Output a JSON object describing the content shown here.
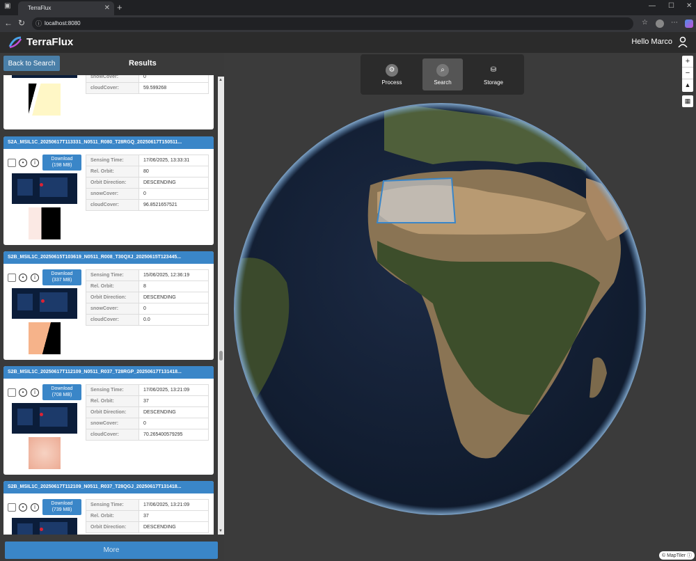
{
  "browser": {
    "tab_title": "TerraFlux",
    "url": "localhost:8080"
  },
  "app": {
    "name": "TerraFlux",
    "greeting": "Hello Marco"
  },
  "panel": {
    "back_label": "Back to Search",
    "title": "Results",
    "more_label": "More"
  },
  "labels": {
    "sensing_time": "Sensing Time:",
    "rel_orbit": "Rel. Orbit:",
    "orbit_direction": "Orbit Direction:",
    "snow_cover": "snowCover:",
    "cloud_cover": "cloudCover:",
    "download": "Download"
  },
  "partial_card": {
    "snowCover": "0",
    "cloudCover": "59.599268"
  },
  "cards": [
    {
      "title": "S2A_MSIL1C_20250617T113331_N0511_R080_T28RGQ_20250617T150511...",
      "size": "(198 MB)",
      "sensing_time": "17/06/2025, 13:33:31",
      "rel_orbit": "80",
      "orbit_direction": "DESCENDING",
      "snowCover": "0",
      "cloudCover": "96.8521657521"
    },
    {
      "title": "S2B_MSIL1C_20250615T103619_N0511_R008_T30QXJ_20250615T123445...",
      "size": "(337 MB)",
      "sensing_time": "15/06/2025, 12:36:19",
      "rel_orbit": "8",
      "orbit_direction": "DESCENDING",
      "snowCover": "0",
      "cloudCover": "0.0"
    },
    {
      "title": "S2B_MSIL1C_20250617T112109_N0511_R037_T28RGP_20250617T131418...",
      "size": "(708 MB)",
      "sensing_time": "17/06/2025, 13:21:09",
      "rel_orbit": "37",
      "orbit_direction": "DESCENDING",
      "snowCover": "0",
      "cloudCover": "70.265400579295"
    },
    {
      "title": "S2B_MSIL1C_20250617T112109_N0511_R037_T28QGJ_20250617T131418...",
      "size": "(739 MB)",
      "sensing_time": "17/06/2025, 13:21:09",
      "rel_orbit": "37",
      "orbit_direction": "DESCENDING"
    }
  ],
  "toolbar": {
    "process": "Process",
    "search": "Search",
    "storage": "Storage"
  },
  "map": {
    "attribution": "© MapTiler"
  },
  "colors": {
    "accent": "#3a86c8",
    "footprint": "#3a86c8"
  }
}
